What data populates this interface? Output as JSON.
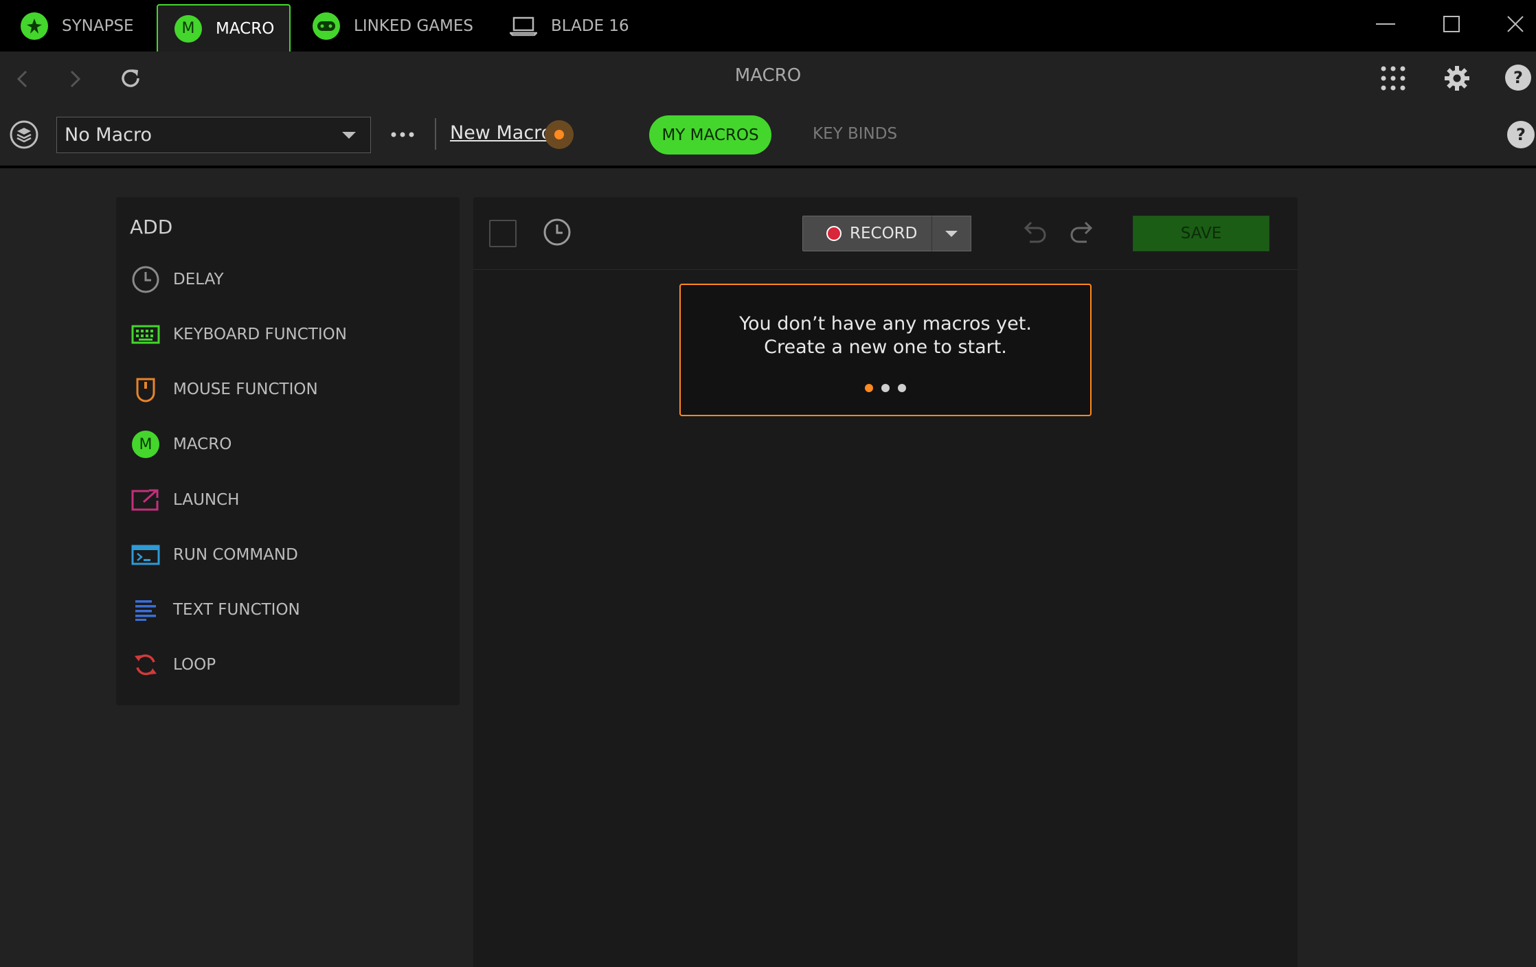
{
  "app_tabs": [
    {
      "label": "SYNAPSE",
      "icon": "razer-logo-icon"
    },
    {
      "label": "MACRO",
      "icon": "macro-m-icon",
      "glyph": "M"
    },
    {
      "label": "LINKED GAMES",
      "icon": "gamepad-icon"
    },
    {
      "label": "BLADE 16",
      "icon": "laptop-icon"
    }
  ],
  "nav": {
    "title": "MACRO"
  },
  "toolbar": {
    "macro_select": "No Macro",
    "new_macro": "New Macro",
    "tabs": [
      {
        "label": "MY MACROS"
      },
      {
        "label": "KEY BINDS"
      }
    ]
  },
  "add_panel": {
    "title": "ADD",
    "items": [
      {
        "label": "DELAY",
        "icon": "clock-icon"
      },
      {
        "label": "KEYBOARD FUNCTION",
        "icon": "keyboard-icon"
      },
      {
        "label": "MOUSE FUNCTION",
        "icon": "mouse-icon"
      },
      {
        "label": "MACRO",
        "icon": "macro-m-icon",
        "glyph": "M"
      },
      {
        "label": "LAUNCH",
        "icon": "launch-icon"
      },
      {
        "label": "RUN COMMAND",
        "icon": "terminal-icon"
      },
      {
        "label": "TEXT FUNCTION",
        "icon": "text-lines-icon"
      },
      {
        "label": "LOOP",
        "icon": "loop-icon"
      }
    ]
  },
  "editor": {
    "record_label": "RECORD",
    "save_label": "SAVE",
    "tooltip": {
      "text": "You don’t have any macros yet. Create a new one to start.",
      "current_step": 1,
      "total_steps": 3
    }
  },
  "colors": {
    "accent_green": "#44d62c",
    "orange": "#ff8a1f",
    "keyboard_green": "#44d62c",
    "mouse_orange": "#e8842a",
    "launch_magenta": "#c2307a",
    "run_blue": "#2e9bd6",
    "text_blue": "#3b6fd8",
    "loop_red": "#d23a3a",
    "record_red": "#d8263a"
  }
}
